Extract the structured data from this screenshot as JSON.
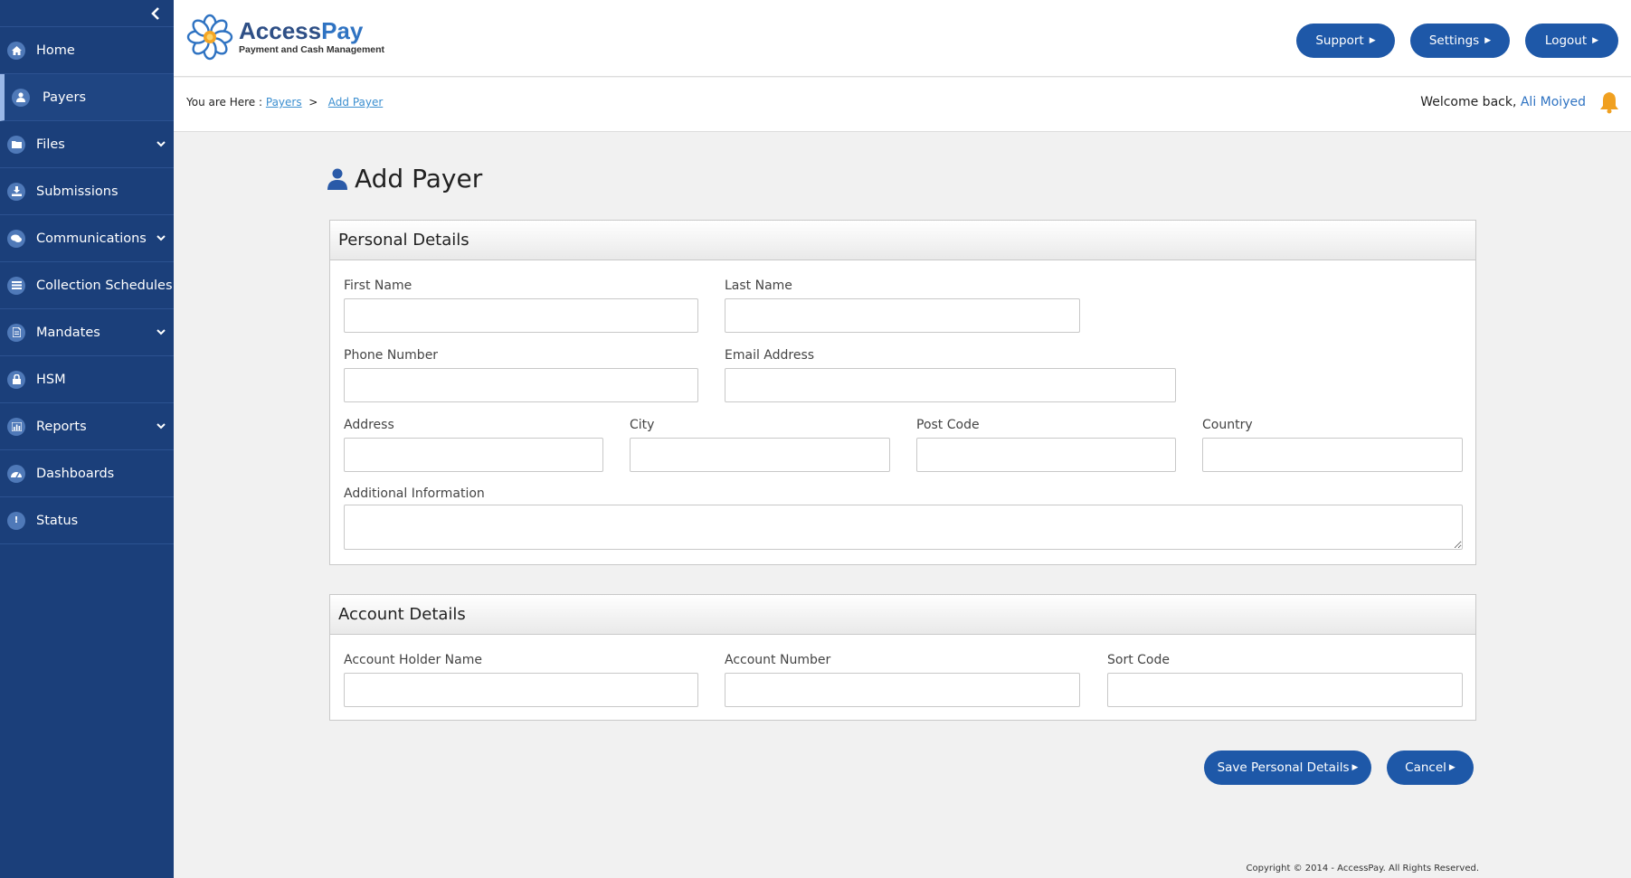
{
  "sidebar": {
    "items": [
      {
        "label": "Home",
        "icon": "home-icon"
      },
      {
        "label": "Payers",
        "icon": "user-icon"
      },
      {
        "label": "Files",
        "icon": "folder-icon"
      },
      {
        "label": "Submissions",
        "icon": "download-icon"
      },
      {
        "label": "Communications",
        "icon": "chat-icon"
      },
      {
        "label": "Collection Schedules",
        "icon": "schedule-icon"
      },
      {
        "label": "Mandates",
        "icon": "document-icon"
      },
      {
        "label": "HSM",
        "icon": "lock-icon"
      },
      {
        "label": "Reports",
        "icon": "bar-chart-icon"
      },
      {
        "label": "Dashboards",
        "icon": "dashboard-icon"
      },
      {
        "label": "Status",
        "icon": "exclamation-icon"
      }
    ]
  },
  "header": {
    "logo_title_a": "Access",
    "logo_title_b": "Pay",
    "logo_subtitle": "Payment and Cash Management",
    "support": "Support",
    "settings": "Settings",
    "logout": "Logout"
  },
  "breadcrumb": {
    "prefix": "You are Here :",
    "payers": "Payers",
    "separator": ">",
    "current": "Add Payer"
  },
  "welcome": {
    "text": "Welcome back,",
    "user": "Ali Moiyed"
  },
  "page": {
    "title": "Add Payer"
  },
  "personal": {
    "heading": "Personal Details",
    "first_name": "First Name",
    "last_name": "Last Name",
    "phone": "Phone Number",
    "email": "Email Address",
    "address": "Address",
    "city": "City",
    "post_code": "Post Code",
    "country": "Country",
    "additional": "Additional Information"
  },
  "account": {
    "heading": "Account Details",
    "holder": "Account Holder Name",
    "number": "Account Number",
    "sort_code": "Sort Code"
  },
  "actions": {
    "save": "Save Personal Details",
    "cancel": "Cancel"
  },
  "footer": {
    "copyright": "Copyright © 2014 - AccessPay. All Rights Reserved."
  },
  "colors": {
    "sidebar": "#1b3f7a",
    "primary_button": "#1e58a8",
    "link": "#3c8fd0",
    "bell": "#f0a020"
  }
}
